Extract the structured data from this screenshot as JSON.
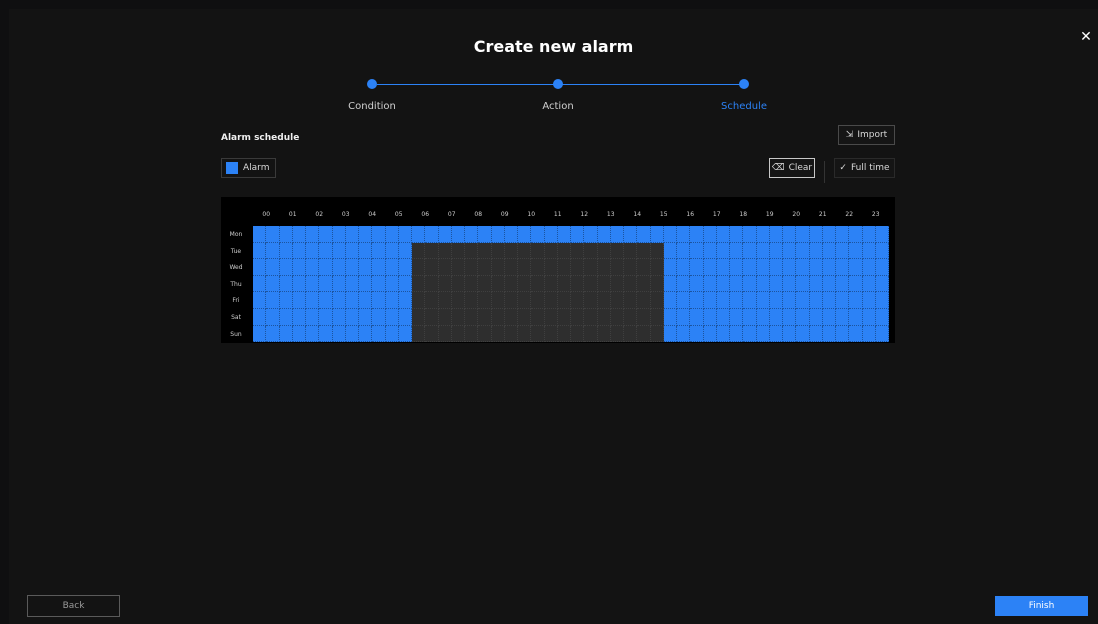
{
  "dialog": {
    "title": "Create new alarm",
    "close_icon": "close-icon"
  },
  "steps": [
    {
      "label": "Condition",
      "active": false
    },
    {
      "label": "Action",
      "active": false
    },
    {
      "label": "Schedule",
      "active": true
    }
  ],
  "schedule": {
    "section_title": "Alarm schedule",
    "import_label": "Import",
    "import_icon": "import-icon",
    "legend_label": "Alarm",
    "clear_label": "Clear",
    "clear_icon": "eraser-icon",
    "full_time_label": "Full time",
    "full_time_icon": "checkmark-icon",
    "hours": [
      "00",
      "01",
      "02",
      "03",
      "04",
      "05",
      "06",
      "07",
      "08",
      "09",
      "10",
      "11",
      "12",
      "13",
      "14",
      "15",
      "16",
      "17",
      "18",
      "19",
      "20",
      "21",
      "22",
      "23"
    ],
    "days": [
      "Mon",
      "Tue",
      "Wed",
      "Thu",
      "Fri",
      "Sat",
      "Sun"
    ],
    "active_color": "#2c82f6",
    "inactive_color": "#2e2e2e",
    "rows": [
      {
        "day": "Mon",
        "on_hours": [
          [
            0,
            24
          ]
        ]
      },
      {
        "day": "Tue",
        "on_hours": [
          [
            0,
            6
          ],
          [
            15.5,
            24
          ]
        ]
      },
      {
        "day": "Wed",
        "on_hours": [
          [
            0,
            6
          ],
          [
            15.5,
            24
          ]
        ]
      },
      {
        "day": "Thu",
        "on_hours": [
          [
            0,
            6
          ],
          [
            15.5,
            24
          ]
        ]
      },
      {
        "day": "Fri",
        "on_hours": [
          [
            0,
            6
          ],
          [
            15.5,
            24
          ]
        ]
      },
      {
        "day": "Sat",
        "on_hours": [
          [
            0,
            6
          ],
          [
            15.5,
            24
          ]
        ]
      },
      {
        "day": "Sun",
        "on_hours": [
          [
            0,
            6
          ],
          [
            15.5,
            24
          ]
        ]
      }
    ]
  },
  "footer": {
    "back_label": "Back",
    "finish_label": "Finish"
  }
}
